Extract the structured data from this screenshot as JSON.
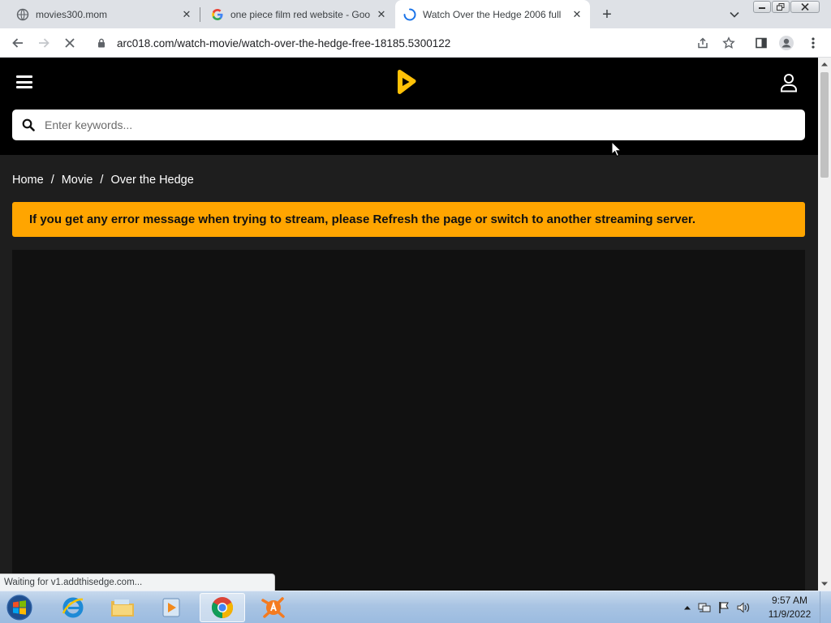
{
  "browser": {
    "tabs": [
      {
        "title": "movies300.mom",
        "icon": "globe-icon",
        "active": false
      },
      {
        "title": "one piece film red website - Goo",
        "icon": "google-icon",
        "active": false
      },
      {
        "title": "Watch Over the Hedge 2006 full",
        "icon": "loading-spinner-icon",
        "active": true
      }
    ],
    "url": "arc018.com/watch-movie/watch-over-the-hedge-free-18185.5300122",
    "status_text": "Waiting for v1.addthisedge.com..."
  },
  "site": {
    "search_placeholder": "Enter keywords...",
    "accent_color": "#ffa500",
    "breadcrumb": [
      {
        "label": "Home"
      },
      {
        "label": "Movie"
      },
      {
        "label": "Over the Hedge"
      }
    ],
    "breadcrumb_separator": "/",
    "alert_text": "If you get any error message when trying to stream, please Refresh the page or switch to another streaming server."
  },
  "taskbar": {
    "apps": [
      "internet-explorer-icon",
      "file-explorer-icon",
      "media-player-icon",
      "chrome-icon",
      "avast-icon"
    ],
    "active_app": "chrome-icon",
    "time": "9:57 AM",
    "date": "11/9/2022"
  }
}
